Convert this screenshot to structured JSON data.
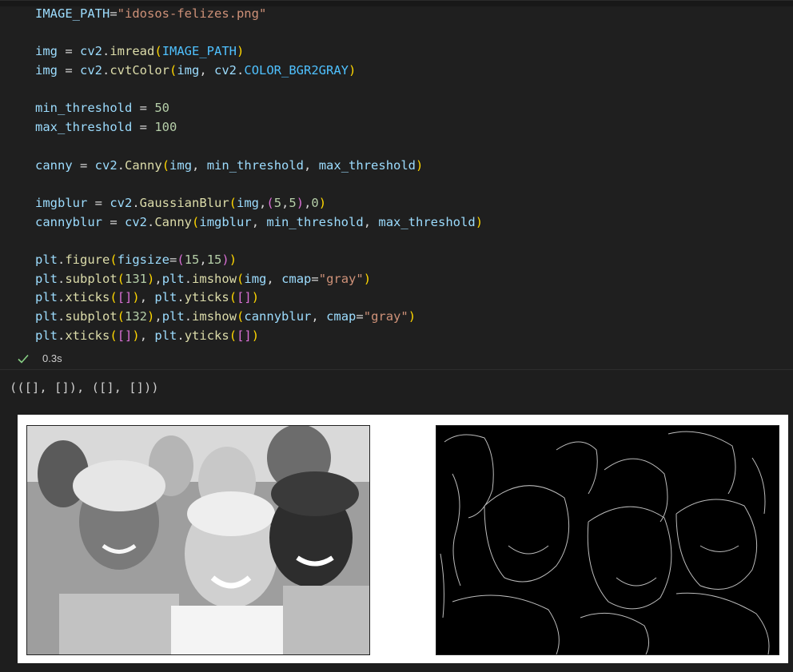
{
  "code_lines": [
    [
      [
        "v",
        "IMAGE_PATH"
      ],
      [
        "p",
        "="
      ],
      [
        "s",
        "\"idosos-felizes.png\""
      ]
    ],
    [],
    [
      [
        "v",
        "img"
      ],
      [
        "p",
        " = "
      ],
      [
        "v",
        "cv2"
      ],
      [
        "p",
        "."
      ],
      [
        "f",
        "imread"
      ],
      [
        "b1",
        "("
      ],
      [
        "c",
        "IMAGE_PATH"
      ],
      [
        "b1",
        ")"
      ]
    ],
    [
      [
        "v",
        "img"
      ],
      [
        "p",
        " = "
      ],
      [
        "v",
        "cv2"
      ],
      [
        "p",
        "."
      ],
      [
        "f",
        "cvtColor"
      ],
      [
        "b1",
        "("
      ],
      [
        "v",
        "img"
      ],
      [
        "p",
        ", "
      ],
      [
        "v",
        "cv2"
      ],
      [
        "p",
        "."
      ],
      [
        "c",
        "COLOR_BGR2GRAY"
      ],
      [
        "b1",
        ")"
      ]
    ],
    [],
    [
      [
        "v",
        "min_threshold"
      ],
      [
        "p",
        " = "
      ],
      [
        "n",
        "50"
      ]
    ],
    [
      [
        "v",
        "max_threshold"
      ],
      [
        "p",
        " = "
      ],
      [
        "n",
        "100"
      ]
    ],
    [],
    [
      [
        "v",
        "canny"
      ],
      [
        "p",
        " = "
      ],
      [
        "v",
        "cv2"
      ],
      [
        "p",
        "."
      ],
      [
        "f",
        "Canny"
      ],
      [
        "b1",
        "("
      ],
      [
        "v",
        "img"
      ],
      [
        "p",
        ", "
      ],
      [
        "v",
        "min_threshold"
      ],
      [
        "p",
        ", "
      ],
      [
        "v",
        "max_threshold"
      ],
      [
        "b1",
        ")"
      ]
    ],
    [],
    [
      [
        "v",
        "imgblur"
      ],
      [
        "p",
        " = "
      ],
      [
        "v",
        "cv2"
      ],
      [
        "p",
        "."
      ],
      [
        "f",
        "GaussianBlur"
      ],
      [
        "b1",
        "("
      ],
      [
        "v",
        "img"
      ],
      [
        "p",
        ","
      ],
      [
        "b2",
        "("
      ],
      [
        "n",
        "5"
      ],
      [
        "p",
        ","
      ],
      [
        "n",
        "5"
      ],
      [
        "b2",
        ")"
      ],
      [
        "p",
        ","
      ],
      [
        "n",
        "0"
      ],
      [
        "b1",
        ")"
      ]
    ],
    [
      [
        "v",
        "cannyblur"
      ],
      [
        "p",
        " = "
      ],
      [
        "v",
        "cv2"
      ],
      [
        "p",
        "."
      ],
      [
        "f",
        "Canny"
      ],
      [
        "b1",
        "("
      ],
      [
        "v",
        "imgblur"
      ],
      [
        "p",
        ", "
      ],
      [
        "v",
        "min_threshold"
      ],
      [
        "p",
        ", "
      ],
      [
        "v",
        "max_threshold"
      ],
      [
        "b1",
        ")"
      ]
    ],
    [],
    [
      [
        "v",
        "plt"
      ],
      [
        "p",
        "."
      ],
      [
        "f",
        "figure"
      ],
      [
        "b1",
        "("
      ],
      [
        "v",
        "figsize"
      ],
      [
        "p",
        "="
      ],
      [
        "b2",
        "("
      ],
      [
        "n",
        "15"
      ],
      [
        "p",
        ","
      ],
      [
        "n",
        "15"
      ],
      [
        "b2",
        ")"
      ],
      [
        "b1",
        ")"
      ]
    ],
    [
      [
        "v",
        "plt"
      ],
      [
        "p",
        "."
      ],
      [
        "f",
        "subplot"
      ],
      [
        "b1",
        "("
      ],
      [
        "n",
        "131"
      ],
      [
        "b1",
        ")"
      ],
      [
        "p",
        ","
      ],
      [
        "v",
        "plt"
      ],
      [
        "p",
        "."
      ],
      [
        "f",
        "imshow"
      ],
      [
        "b1",
        "("
      ],
      [
        "v",
        "img"
      ],
      [
        "p",
        ", "
      ],
      [
        "v",
        "cmap"
      ],
      [
        "p",
        "="
      ],
      [
        "s",
        "\"gray\""
      ],
      [
        "b1",
        ")"
      ]
    ],
    [
      [
        "v",
        "plt"
      ],
      [
        "p",
        "."
      ],
      [
        "f",
        "xticks"
      ],
      [
        "b1",
        "("
      ],
      [
        "b2",
        "[]"
      ],
      [
        "b1",
        ")"
      ],
      [
        "p",
        ", "
      ],
      [
        "v",
        "plt"
      ],
      [
        "p",
        "."
      ],
      [
        "f",
        "yticks"
      ],
      [
        "b1",
        "("
      ],
      [
        "b2",
        "[]"
      ],
      [
        "b1",
        ")"
      ]
    ],
    [
      [
        "v",
        "plt"
      ],
      [
        "p",
        "."
      ],
      [
        "f",
        "subplot"
      ],
      [
        "b1",
        "("
      ],
      [
        "n",
        "132"
      ],
      [
        "b1",
        ")"
      ],
      [
        "p",
        ","
      ],
      [
        "v",
        "plt"
      ],
      [
        "p",
        "."
      ],
      [
        "f",
        "imshow"
      ],
      [
        "b1",
        "("
      ],
      [
        "v",
        "cannyblur"
      ],
      [
        "p",
        ", "
      ],
      [
        "v",
        "cmap"
      ],
      [
        "p",
        "="
      ],
      [
        "s",
        "\"gray\""
      ],
      [
        "b1",
        ")"
      ]
    ],
    [
      [
        "v",
        "plt"
      ],
      [
        "p",
        "."
      ],
      [
        "f",
        "xticks"
      ],
      [
        "b1",
        "("
      ],
      [
        "b2",
        "[]"
      ],
      [
        "b1",
        ")"
      ],
      [
        "p",
        ", "
      ],
      [
        "v",
        "plt"
      ],
      [
        "p",
        "."
      ],
      [
        "f",
        "yticks"
      ],
      [
        "b1",
        "("
      ],
      [
        "b2",
        "[]"
      ],
      [
        "b1",
        ")"
      ]
    ]
  ],
  "execution": {
    "status_icon": "check-icon",
    "status_color": "#89d185",
    "duration": "0.3s"
  },
  "output": {
    "text": "(([], []), ([], []))"
  },
  "figure": {
    "left_panel": "grayscale-photo",
    "right_panel": "canny-edges"
  }
}
